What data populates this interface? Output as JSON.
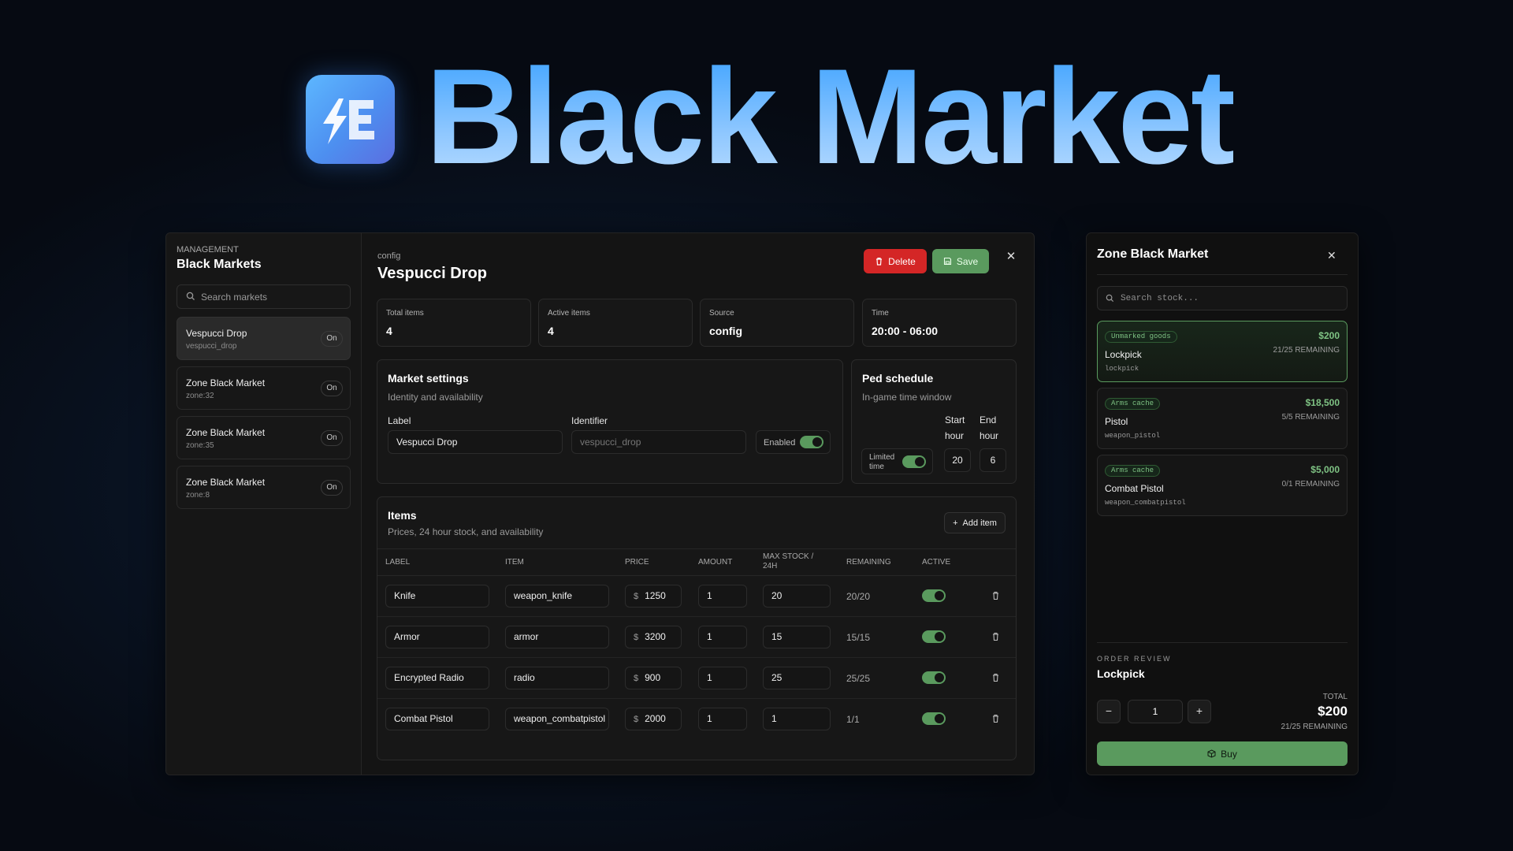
{
  "hero": {
    "title": "Black Market",
    "logo_letter": "E"
  },
  "sidebar": {
    "caption": "MANAGEMENT",
    "title": "Black Markets",
    "search_placeholder": "Search markets",
    "items": [
      {
        "name": "Vespucci Drop",
        "id": "vespucci_drop",
        "status": "On"
      },
      {
        "name": "Zone Black Market",
        "id": "zone:32",
        "status": "On"
      },
      {
        "name": "Zone Black Market",
        "id": "zone:35",
        "status": "On"
      },
      {
        "name": "Zone Black Market",
        "id": "zone:8",
        "status": "On"
      }
    ]
  },
  "main": {
    "caption": "config",
    "title": "Vespucci Drop",
    "delete_label": "Delete",
    "save_label": "Save",
    "stats": [
      {
        "label": "Total items",
        "value": "4"
      },
      {
        "label": "Active items",
        "value": "4"
      },
      {
        "label": "Source",
        "value": "config"
      },
      {
        "label": "Time",
        "value": "20:00 - 06:00"
      }
    ],
    "settings": {
      "title": "Market settings",
      "subtitle": "Identity and availability",
      "label_label": "Label",
      "label_value": "Vespucci Drop",
      "identifier_label": "Identifier",
      "identifier_value": "vespucci_drop",
      "enabled_label": "Enabled"
    },
    "schedule": {
      "title": "Ped schedule",
      "subtitle": "In-game time window",
      "limited_label": "Limited time",
      "start_label_1": "Start",
      "start_label_2": "hour",
      "end_label_1": "End",
      "end_label_2": "hour",
      "start_value": "20",
      "end_value": "6"
    },
    "items": {
      "title": "Items",
      "subtitle": "Prices, 24 hour stock, and availability",
      "add_label": "Add item",
      "currency": "$",
      "columns": [
        "LABEL",
        "ITEM",
        "PRICE",
        "AMOUNT",
        "MAX STOCK /",
        "24H",
        "REMAINING",
        "ACTIVE"
      ],
      "rows": [
        {
          "label": "Knife",
          "item": "weapon_knife",
          "price": "1250",
          "amount": "1",
          "max": "20",
          "remaining": "20/20"
        },
        {
          "label": "Armor",
          "item": "armor",
          "price": "3200",
          "amount": "1",
          "max": "15",
          "remaining": "15/15"
        },
        {
          "label": "Encrypted Radio",
          "item": "radio",
          "price": "900",
          "amount": "1",
          "max": "25",
          "remaining": "25/25"
        },
        {
          "label": "Combat Pistol",
          "item": "weapon_combatpistol",
          "price": "2000",
          "amount": "1",
          "max": "1",
          "remaining": "1/1"
        }
      ]
    }
  },
  "zone": {
    "title": "Zone Black Market",
    "search_placeholder": "Search stock...",
    "items": [
      {
        "tag": "Unmarked goods",
        "price": "$200",
        "name": "Lockpick",
        "remaining": "21/25 REMAINING",
        "code": "lockpick"
      },
      {
        "tag": "Arms cache",
        "price": "$18,500",
        "name": "Pistol",
        "remaining": "5/5 REMAINING",
        "code": "weapon_pistol"
      },
      {
        "tag": "Arms cache",
        "price": "$5,000",
        "name": "Combat Pistol",
        "remaining": "0/1 REMAINING",
        "code": "weapon_combatpistol"
      }
    ],
    "order": {
      "caption": "ORDER REVIEW",
      "item": "Lockpick",
      "minus": "−",
      "plus": "+",
      "quantity": "1",
      "total_label": "TOTAL",
      "total_value": "$200",
      "remaining": "21/25 REMAINING",
      "buy_label": "Buy"
    }
  },
  "colors": {
    "accent_green": "#5a9a5e",
    "danger_red": "#d42626",
    "hero_blue": "#3da2ff"
  }
}
